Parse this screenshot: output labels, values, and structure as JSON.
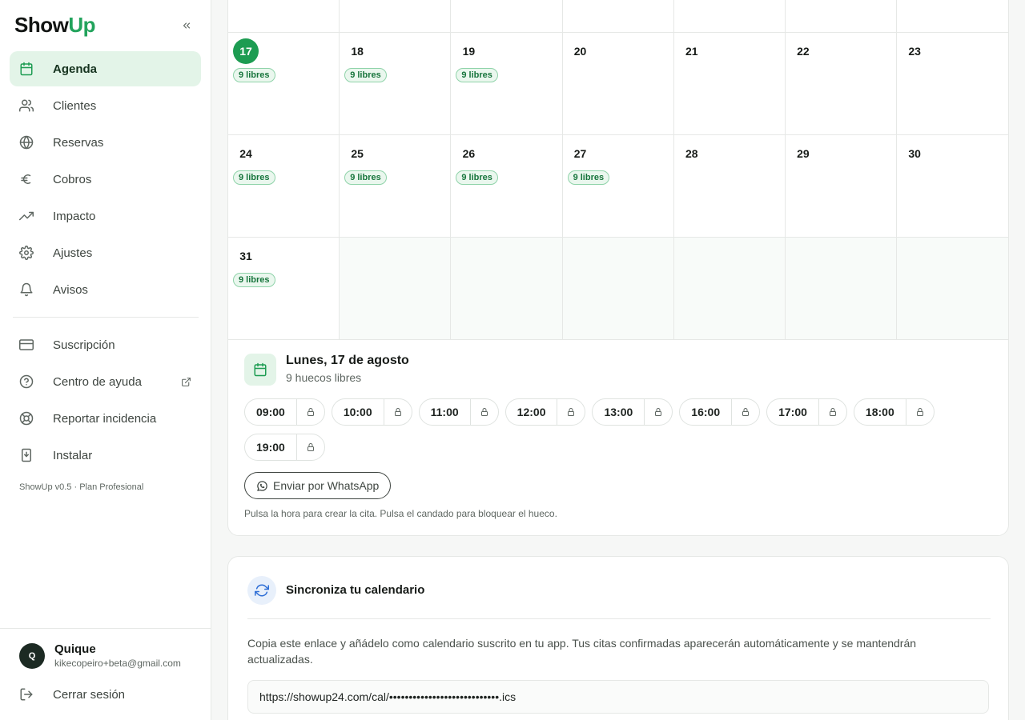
{
  "app": {
    "logo_part1": "Show",
    "logo_part2": "Up",
    "brand_color": "#22a35c"
  },
  "sidebar": {
    "collapse_icon": "chevrons-left-icon",
    "items": [
      {
        "label": "Agenda",
        "icon": "calendar-icon",
        "active": true
      },
      {
        "label": "Clientes",
        "icon": "users-icon"
      },
      {
        "label": "Reservas",
        "icon": "globe-icon"
      },
      {
        "label": "Cobros",
        "icon": "euro-icon"
      },
      {
        "label": "Impacto",
        "icon": "trending-up-icon"
      },
      {
        "label": "Ajustes",
        "icon": "gear-icon"
      },
      {
        "label": "Avisos",
        "icon": "bell-icon"
      }
    ],
    "secondary_items": [
      {
        "label": "Suscripción",
        "icon": "credit-card-icon"
      },
      {
        "label": "Centro de ayuda",
        "icon": "help-circle-icon",
        "external_icon": "external-link-icon"
      },
      {
        "label": "Reportar incidencia",
        "icon": "lifebuoy-icon"
      },
      {
        "label": "Instalar",
        "icon": "install-icon"
      }
    ],
    "version": "ShowUp v0.5 · Plan Profesional",
    "user": {
      "initial": "Q",
      "name": "Quique",
      "email": "kikecopeiro+beta@gmail.com"
    },
    "logout_label": "Cerrar sesión"
  },
  "calendar": {
    "rows": [
      [
        {
          "day": ""
        },
        {
          "day": ""
        },
        {
          "day": ""
        },
        {
          "day": ""
        },
        {
          "day": ""
        },
        {
          "day": ""
        },
        {
          "day": ""
        }
      ],
      [
        {
          "day": "17",
          "badge": "9 libres",
          "today": true
        },
        {
          "day": "18",
          "badge": "9 libres"
        },
        {
          "day": "19",
          "badge": "9 libres"
        },
        {
          "day": "20"
        },
        {
          "day": "21"
        },
        {
          "day": "22"
        },
        {
          "day": "23"
        }
      ],
      [
        {
          "day": "24",
          "badge": "9 libres"
        },
        {
          "day": "25",
          "badge": "9 libres"
        },
        {
          "day": "26",
          "badge": "9 libres"
        },
        {
          "day": "27",
          "badge": "9 libres"
        },
        {
          "day": "28"
        },
        {
          "day": "29"
        },
        {
          "day": "30"
        }
      ],
      [
        {
          "day": "31",
          "badge": "9 libres"
        },
        {
          "empty": true
        },
        {
          "empty": true
        },
        {
          "empty": true
        },
        {
          "empty": true
        },
        {
          "empty": true
        },
        {
          "empty": true
        }
      ]
    ],
    "today_color": "#1d9c52"
  },
  "day_panel": {
    "icon": "calendar-icon",
    "title": "Lunes, 17 de agosto",
    "subtitle": "9 huecos libres",
    "slots": [
      "09:00",
      "10:00",
      "11:00",
      "12:00",
      "13:00",
      "16:00",
      "17:00",
      "18:00",
      "19:00"
    ],
    "slot_lock_icon": "lock-icon",
    "whatsapp_label": "Enviar por WhatsApp",
    "whatsapp_icon": "whatsapp-icon",
    "hint": "Pulsa la hora para crear la cita. Pulsa el candado para bloquear el hueco."
  },
  "sync": {
    "icon": "refresh-icon",
    "title": "Sincroniza tu calendario",
    "description": "Copia este enlace y añádelo como calendario suscrito en tu app. Tus citas confirmadas aparecerán automáticamente y se mantendrán actualizadas.",
    "url": "https://showup24.com/cal/••••••••••••••••••••••••••••.ics"
  }
}
